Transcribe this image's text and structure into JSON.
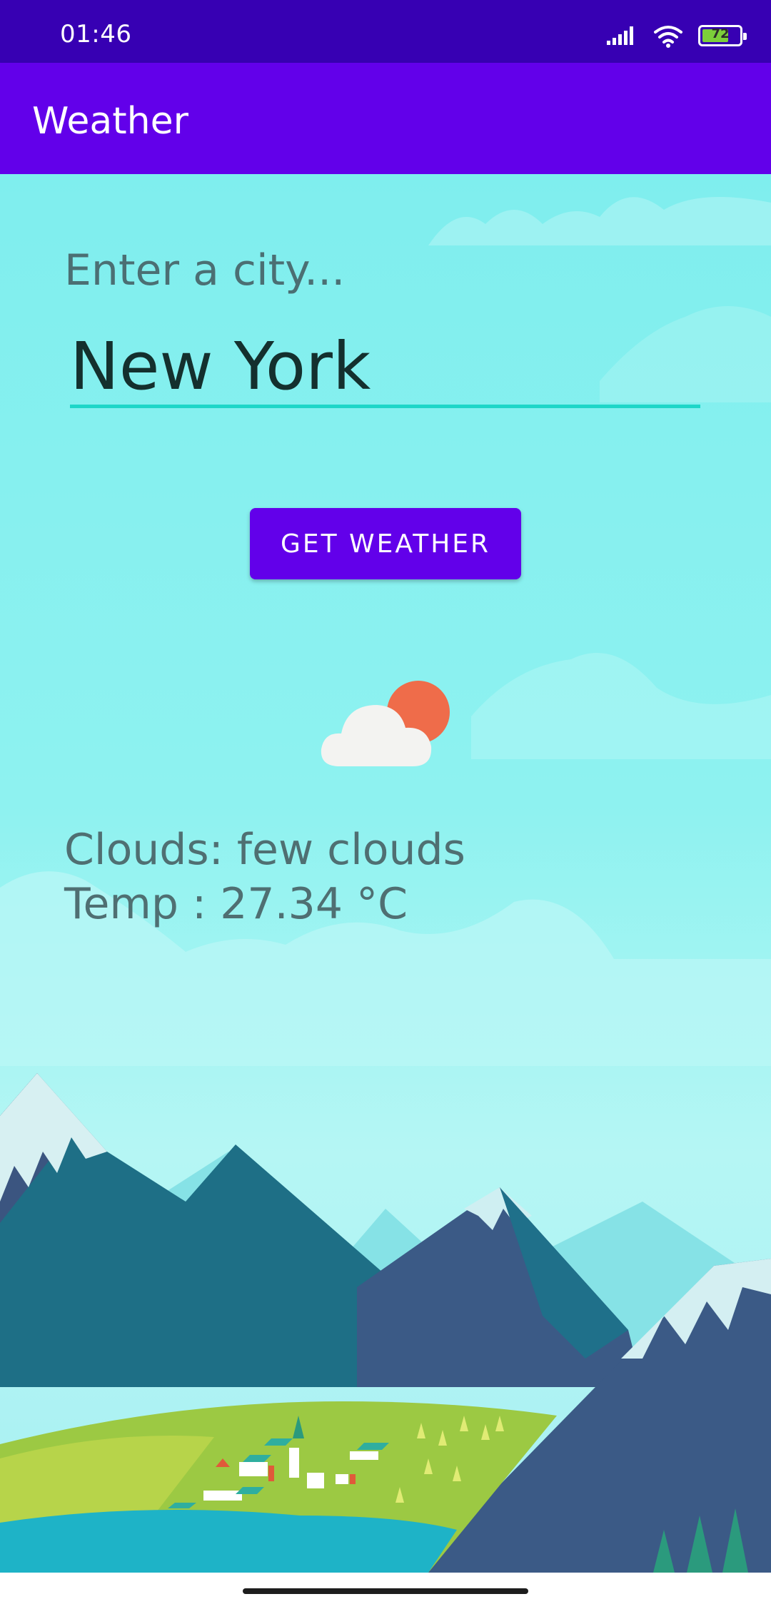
{
  "status_bar": {
    "time": "01:46",
    "battery_level": 72,
    "battery_label": "72",
    "icons": [
      "signal-icon",
      "wifi-icon",
      "battery-icon"
    ]
  },
  "app_bar": {
    "title": "Weather"
  },
  "form": {
    "city_label": "Enter a city...",
    "city_value": "New York",
    "button_label": "GET WEATHER"
  },
  "result": {
    "icon": "partly-cloudy-icon",
    "description": "Clouds: few clouds",
    "temperature": "Temp : 27.34 °C"
  },
  "colors": {
    "status_bar": "#3700b3",
    "app_bar": "#6200ea",
    "accent": "#1ed6c8",
    "sun": "#ef6c4a"
  }
}
